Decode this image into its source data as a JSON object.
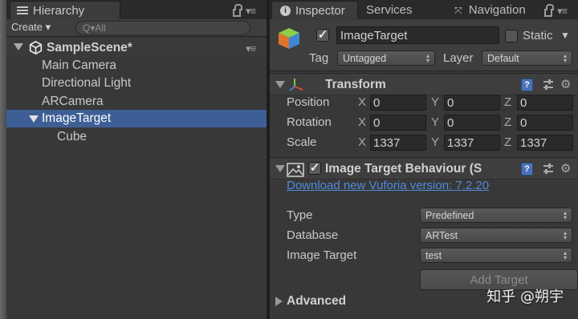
{
  "hierarchy": {
    "tab_label": "Hierarchy",
    "create_label": "Create ▾",
    "search_placeholder": "Q▾All",
    "scene_name": "SampleScene*",
    "items": [
      {
        "label": "Main Camera"
      },
      {
        "label": "Directional Light"
      },
      {
        "label": "ARCamera"
      },
      {
        "label": "ImageTarget"
      },
      {
        "label": "Cube"
      }
    ],
    "selected_item": "ImageTarget"
  },
  "inspector": {
    "tabs": [
      {
        "label": "Inspector"
      },
      {
        "label": "Services"
      },
      {
        "label": "Navigation"
      }
    ],
    "object_name": "ImageTarget",
    "active_checked": true,
    "static_label": "Static",
    "static_checked": false,
    "tag_label": "Tag",
    "tag_value": "Untagged",
    "layer_label": "Layer",
    "layer_value": "Default"
  },
  "transform": {
    "title": "Transform",
    "rows": [
      {
        "label": "Position",
        "x": "0",
        "y": "0",
        "z": "0"
      },
      {
        "label": "Rotation",
        "x": "0",
        "y": "0",
        "z": "0"
      },
      {
        "label": "Scale",
        "x": "1337",
        "y": "1337",
        "z": "1337"
      }
    ],
    "axis_labels": [
      "X",
      "Y",
      "Z"
    ]
  },
  "image_target_behaviour": {
    "title": "Image Target Behaviour (S",
    "enabled": true,
    "download_link": "Download new Vuforia version: 7.2.20",
    "fields": [
      {
        "label": "Type",
        "value": "Predefined"
      },
      {
        "label": "Database",
        "value": "ARTest"
      },
      {
        "label": "Image Target",
        "value": "test"
      }
    ],
    "add_target_label": "Add Target",
    "advanced_label": "Advanced"
  },
  "watermark": "知乎 @朔宇",
  "colors": {
    "selection": "#3e5f96",
    "link": "#4f8ad8",
    "panel": "#383838",
    "help_icon": "#4a72b8"
  }
}
